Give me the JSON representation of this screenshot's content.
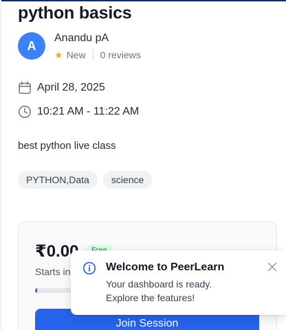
{
  "session": {
    "title": "python basics",
    "host": {
      "initial": "A",
      "name": "Anandu pA",
      "rating_label": "New",
      "reviews": "0 reviews"
    },
    "date": "April 28, 2025",
    "time": "10:21 AM - 11:22 AM",
    "description": "best python live class",
    "tags": [
      "PYTHON,Data",
      "science"
    ]
  },
  "booking": {
    "price": "₹0.00",
    "badge": "Free",
    "starts_text": "Starts in",
    "join_label": "Join Session"
  },
  "toast": {
    "title": "Welcome to PeerLearn",
    "message": "Your dashboard is ready. Explore the features!"
  },
  "colors": {
    "accent": "#2563eb",
    "avatar": "#3b82f6",
    "star": "#f5a524"
  },
  "icons": {
    "date": "calendar-icon",
    "time": "clock-icon",
    "rating": "star-icon",
    "toast": "info-icon",
    "close": "close-icon"
  }
}
